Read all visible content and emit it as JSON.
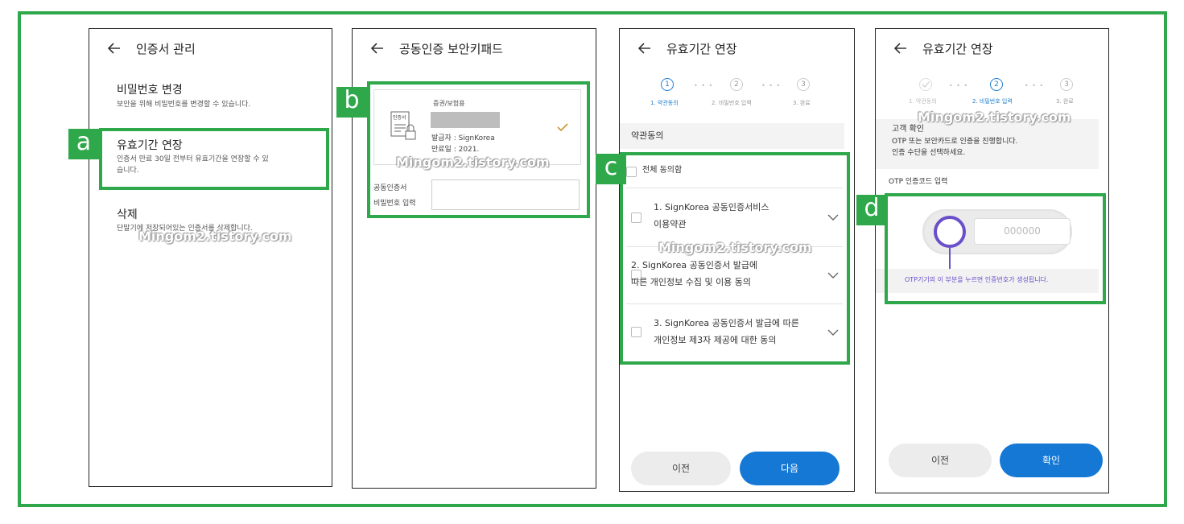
{
  "watermark": "Mingom2.tistory.com",
  "tags": {
    "a": "a",
    "b": "b",
    "c": "c",
    "d": "d"
  },
  "panel_a": {
    "title": "인증서 관리",
    "items": [
      {
        "label": "비밀번호 변경",
        "desc": "보안을 위해 비밀번호를 변경할 수 있습니다."
      },
      {
        "label": "유효기간 연장",
        "desc": "인증서 만료 30일 전부터 유효기간을 연장할 수 있습니다."
      },
      {
        "label": "삭제",
        "desc": "단말기에 저장되어있는 인증서를 삭제합니다."
      }
    ]
  },
  "panel_b": {
    "title": "공동인증 보안키패드",
    "cert_icon_label": "인증서",
    "cert_type": "증권/보험용",
    "issuer": "발급자 : SignKorea",
    "expiry": "만료일 : 2021.",
    "pw_label_1": "공동인증서",
    "pw_label_2": "비밀번호 입력"
  },
  "panel_c": {
    "title": "유효기간 연장",
    "steps": [
      {
        "num": "1",
        "label": "1. 약관동의"
      },
      {
        "num": "2",
        "label": "2. 비밀번호 입력"
      },
      {
        "num": "3",
        "label": "3. 완료"
      }
    ],
    "section": "약관동의",
    "agree_all": "전체 동의함",
    "terms": [
      {
        "line1": "1. SignKorea 공동인증서비스",
        "line2": "이용약관"
      },
      {
        "line1": "2. SignKorea 공동인증서 발급에",
        "line2": "따른 개인정보 수집 및 이용 동의"
      },
      {
        "line1": "3. SignKorea 공동인증서 발급에 따른",
        "line2": "개인정보 제3자 제공에 대한 동의"
      }
    ],
    "prev": "이전",
    "next": "다음"
  },
  "panel_d": {
    "title": "유효기간 연장",
    "steps": [
      {
        "num": "",
        "label": "1. 약관동의"
      },
      {
        "num": "2",
        "label": "2. 비밀번호 입력"
      },
      {
        "num": "3",
        "label": "3. 완료"
      }
    ],
    "section_title": "고객 확인",
    "section_desc_1": "OTP 또는 보안카드로 인증을 진행합니다.",
    "section_desc_2": "인증 수단을 선택하세요.",
    "otp_label": "OTP 인증코드 입력",
    "otp_placeholder": "000000",
    "otp_hint": "OTP기기의 이 부분을 누르면 인증번호가 생성됩니다.",
    "prev": "이전",
    "confirm": "확인"
  },
  "colors": {
    "accent_green": "#2ea84a",
    "primary_blue": "#1478d4",
    "otp_ring": "#6a4fc9"
  }
}
